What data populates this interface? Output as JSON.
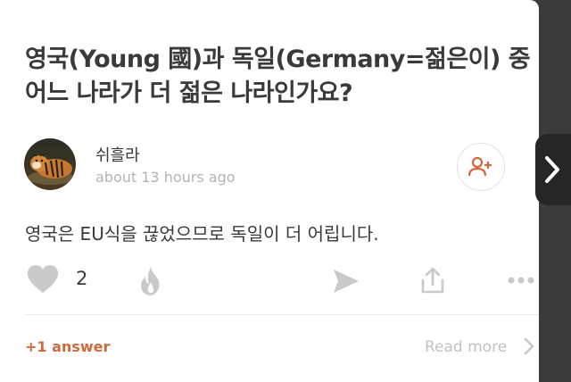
{
  "question": {
    "line1": "영국(Young 國)과 독일(Germany=젊은이) 중",
    "line2": "어느 나라가 더 젊은 나라인가요?"
  },
  "author": {
    "name": "쉬흘라",
    "time": "about 13 hours ago",
    "avatar_icon": "tiger-avatar"
  },
  "answer": {
    "text": "영국은 EU식을 끊었으므로 독일이 더 어립니다."
  },
  "actions": {
    "like_count": "2",
    "icons": [
      "heart-icon",
      "fire-icon",
      "share-arrow-icon",
      "upload-icon",
      "more-dots-icon"
    ]
  },
  "footer": {
    "answers": "+1 answer",
    "read_more": "Read more"
  },
  "colors": {
    "accent": "#d06a3c",
    "icon_gray": "#c9c9c9",
    "background_dark": "#3b3b3b"
  }
}
